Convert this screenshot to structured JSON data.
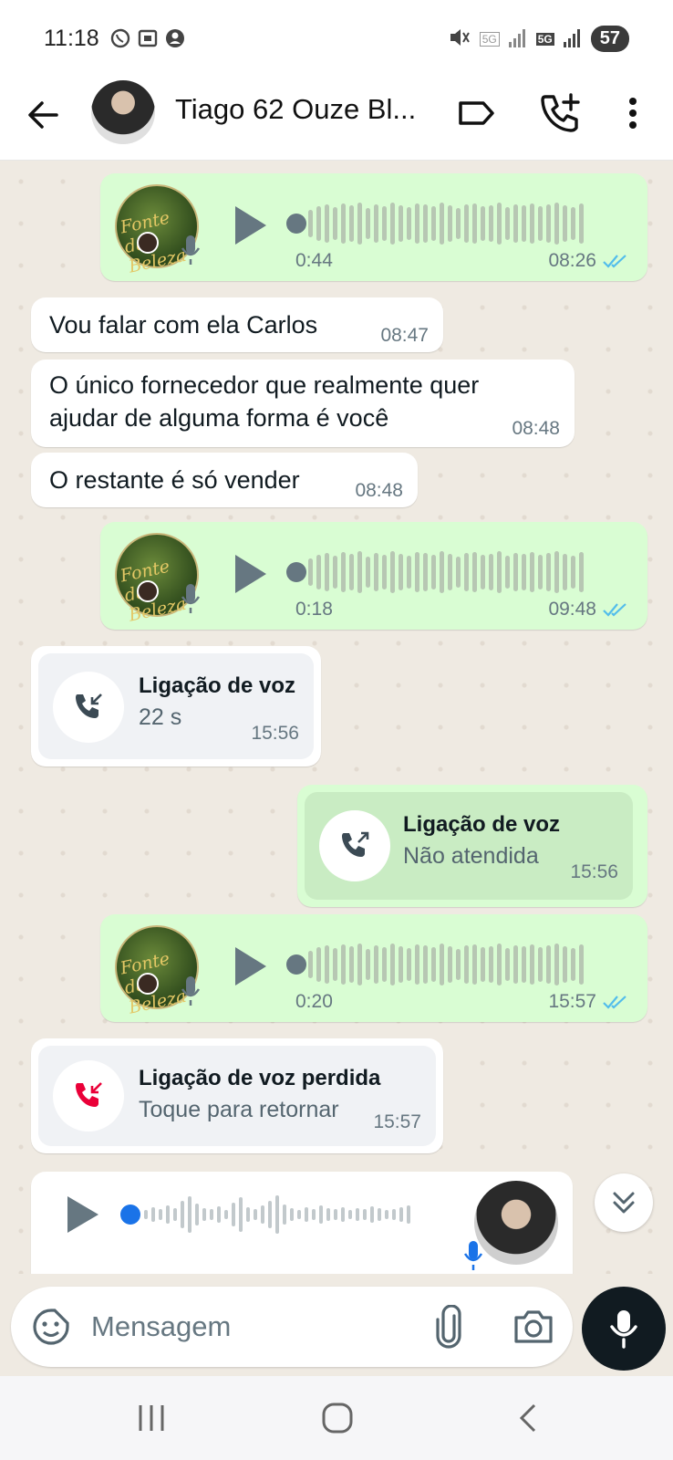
{
  "status_bar": {
    "time": "11:18",
    "network_a": "5G",
    "network_b": "5G",
    "battery": "57"
  },
  "header": {
    "contact_name": "Tiago 62 Ouze Bl..."
  },
  "messages": [
    {
      "type": "voice",
      "direction": "out",
      "duration": "0:44",
      "time": "08:26",
      "avatar_text": "Fonte da Beleza"
    },
    {
      "type": "text",
      "direction": "in",
      "text": "Vou falar com ela Carlos",
      "time": "08:47"
    },
    {
      "type": "text",
      "direction": "in",
      "text_line1": "O único fornecedor que realmente quer",
      "text_line2": "ajudar de alguma forma é você",
      "time": "08:48"
    },
    {
      "type": "text",
      "direction": "in",
      "text": "O restante é só vender",
      "time": "08:48"
    },
    {
      "type": "voice",
      "direction": "out",
      "duration": "0:18",
      "time": "09:48",
      "avatar_text": "Fonte da Beleza"
    },
    {
      "type": "call",
      "direction": "in",
      "title": "Ligação de voz",
      "subtitle": "22 s",
      "time": "15:56"
    },
    {
      "type": "call",
      "direction": "out",
      "title": "Ligação de voz",
      "subtitle": "Não atendida",
      "time": "15:56"
    },
    {
      "type": "voice",
      "direction": "out",
      "duration": "0:20",
      "time": "15:57",
      "avatar_text": "Fonte da Beleza"
    },
    {
      "type": "call",
      "direction": "in",
      "title": "Ligação de voz perdida",
      "subtitle": "Toque para retornar",
      "time": "15:57",
      "missed": true
    },
    {
      "type": "voice",
      "direction": "in",
      "duration": "",
      "time": ""
    }
  ],
  "input": {
    "placeholder": "Mensagem"
  },
  "colors": {
    "out_bubble": "#d9fdd3",
    "in_bubble": "#ffffff",
    "tick_blue": "#53bdeb",
    "missed_red": "#ea0038",
    "background": "#efeae2"
  }
}
